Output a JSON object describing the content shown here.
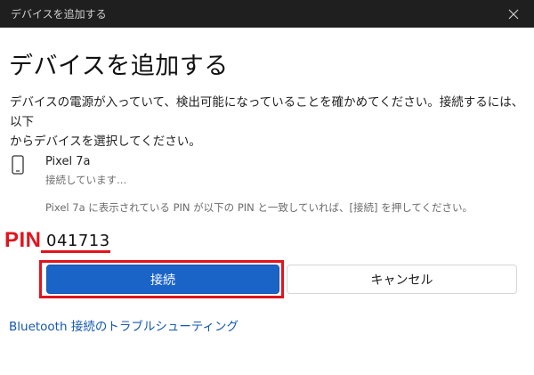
{
  "window": {
    "title": "デバイスを追加する"
  },
  "dialog": {
    "heading": "デバイスを追加する",
    "description_line1": "デバイスの電源が入っていて、検出可能になっていることを確かめてください。接続するには、以下",
    "description_line2": "からデバイスを選択してください。"
  },
  "device": {
    "name": "Pixel 7a",
    "status": "接続しています...",
    "pin_hint": "Pixel 7a に表示されている PIN が以下の PIN と一致していれば、[接続] を押してください。"
  },
  "pin": {
    "label": "PIN",
    "value": "041713"
  },
  "buttons": {
    "connect": "接続",
    "cancel": "キャンセル"
  },
  "link": {
    "troubleshoot": "Bluetooth 接続のトラブルシューティング"
  },
  "icons": {
    "device": "phone-icon",
    "close": "close-icon"
  },
  "colors": {
    "titlebar": "#1f1f1f",
    "accent": "#1a64c8",
    "highlight": "#e0141e",
    "link": "#1558b0"
  }
}
